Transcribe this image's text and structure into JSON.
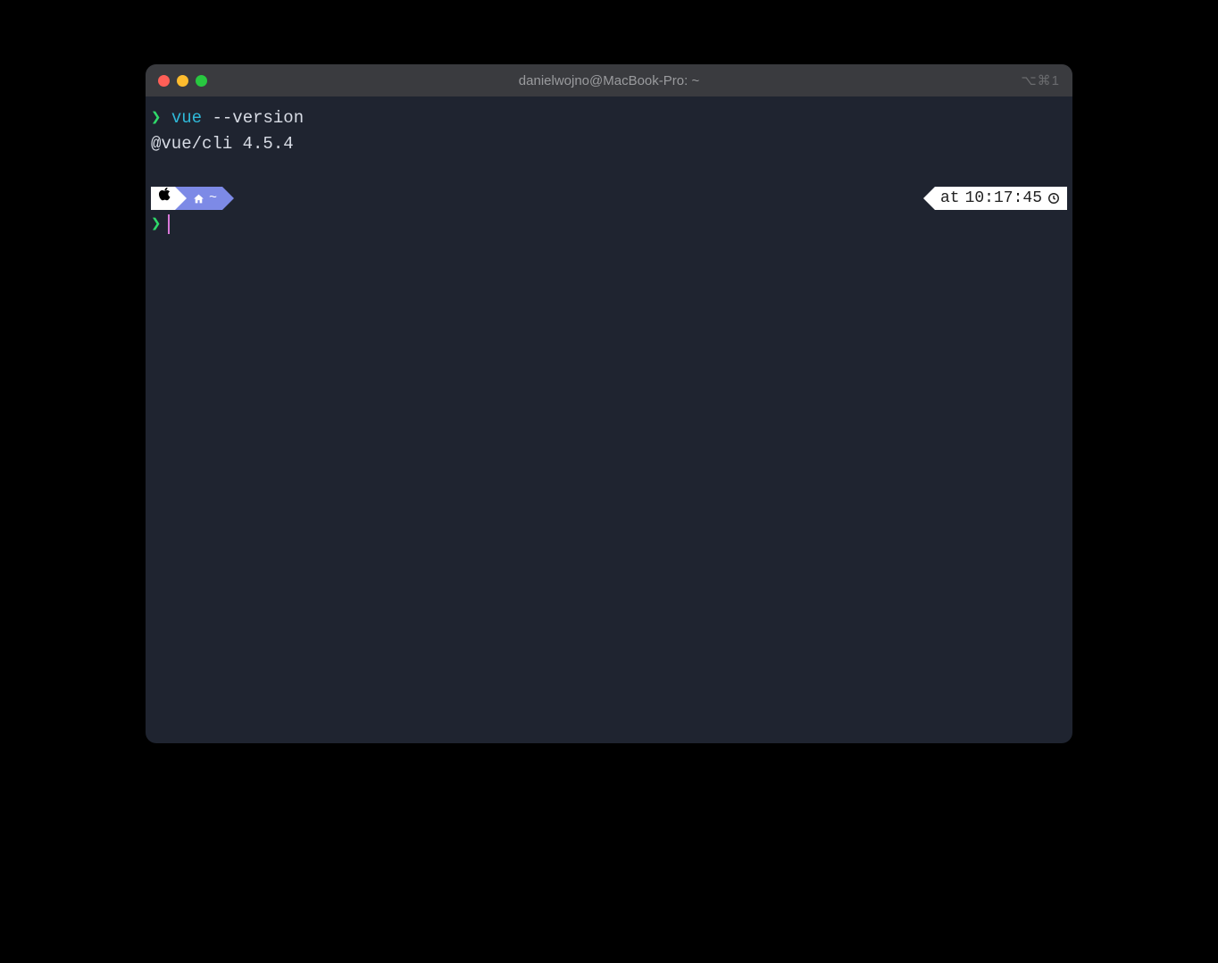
{
  "window": {
    "title": "danielwojno@MacBook-Pro: ~",
    "shortcut_hint": "⌥⌘1"
  },
  "terminal": {
    "prompt_symbol": "❯",
    "command": {
      "name": "vue",
      "args": "--version"
    },
    "output": "@vue/cli 4.5.4",
    "status": {
      "path_symbol": "~",
      "time_prefix": "at",
      "time": "10:17:45"
    }
  }
}
